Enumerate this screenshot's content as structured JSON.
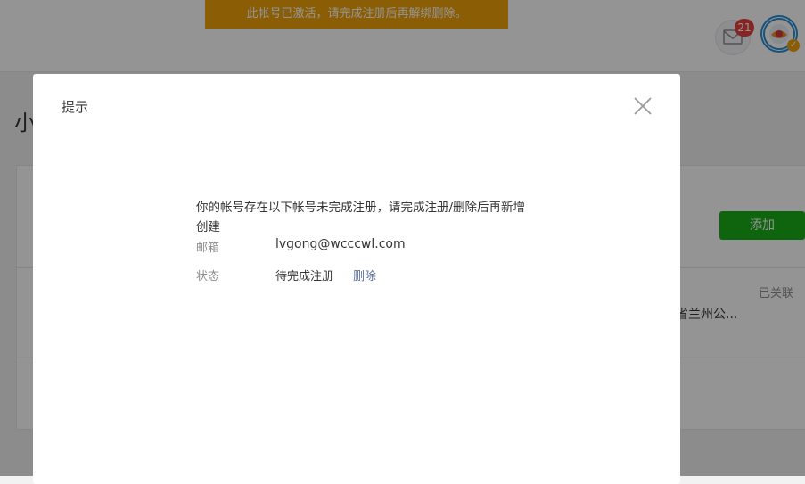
{
  "notice": "此帐号已激活，请完成注册后再解绑删除。",
  "header": {
    "mail_badge": "21"
  },
  "page": {
    "title_partial": "小",
    "add_button": "添加",
    "status_linked": "已关联",
    "org_name_partial": "省兰州公..."
  },
  "dialog": {
    "title": "提示",
    "message": "你的帐号存在以下帐号未完成注册，请完成注册/删除后再新增创建",
    "email_label": "邮箱",
    "email_value": "lvgong@wcccwl.com",
    "status_label": "状态",
    "status_value": "待完成注册",
    "delete_link": "删除"
  },
  "colors": {
    "notice_bg": "#f0a30a",
    "add_button_bg": "#1aad19",
    "link": "#576b95",
    "badge": "#e64340"
  }
}
